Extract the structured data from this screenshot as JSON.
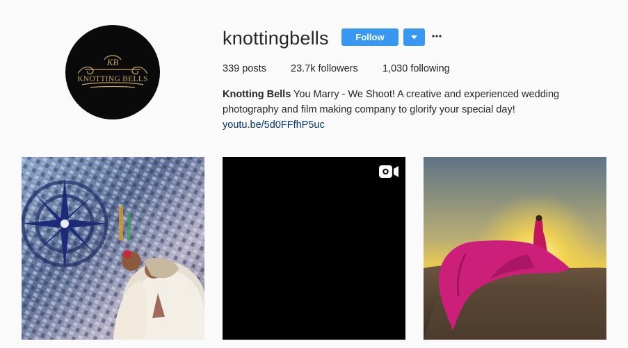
{
  "profile": {
    "username": "knottingbells",
    "avatar_text": "KNOTTING BELLS",
    "avatar_monogram": "KB",
    "follow_label": "Follow",
    "dropdown_icon": "chevron-down-icon",
    "more_icon": "more-options-icon"
  },
  "stats": {
    "posts": "339 posts",
    "followers": "23.7k followers",
    "following": "1,030 following"
  },
  "bio": {
    "name": "Knotting Bells",
    "text_line1": " You Marry - We Shoot! A creative and experienced wedding",
    "text_line2": "photography and film making company to glorify your special day!",
    "link": "youtu.be/5d0FFfhP5uc"
  },
  "posts": [
    {
      "kind": "photo",
      "subject": "mirror mosaic wedding couple"
    },
    {
      "kind": "video",
      "icon": "video-camera-icon"
    },
    {
      "kind": "photo",
      "subject": "woman in flowing pink dress at sunset in desert"
    }
  ],
  "colors": {
    "accent": "#3897f0",
    "link": "#003569",
    "background": "#fafafa",
    "text": "#262626",
    "gold": "#c7a76a"
  }
}
